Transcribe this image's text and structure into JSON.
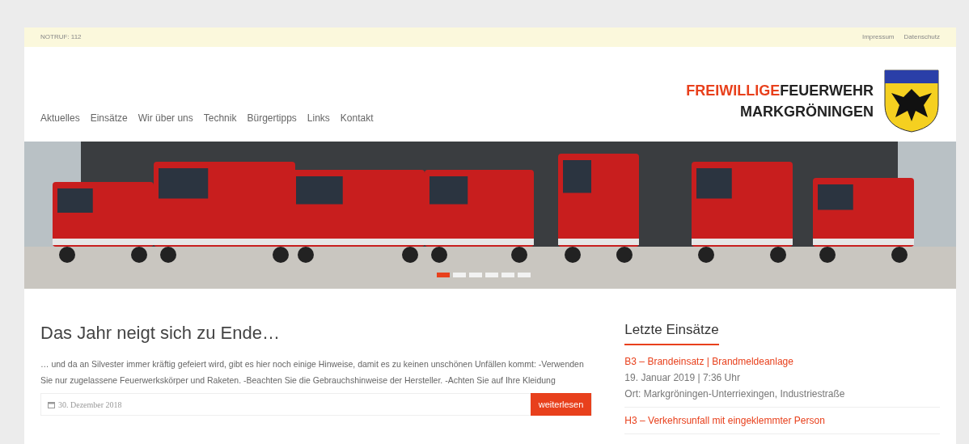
{
  "topbar": {
    "emergency": "NOTRUF: 112",
    "links": [
      "Impressum",
      "Datenschutz"
    ]
  },
  "nav": [
    "Aktuelles",
    "Einsätze",
    "Wir über uns",
    "Technik",
    "Bürgertipps",
    "Links",
    "Kontakt"
  ],
  "logo": {
    "line1_accent": "FREIWILLIGE",
    "line1_rest": "FEUERWEHR",
    "line2": "MARKGRÖNINGEN"
  },
  "slider": {
    "dots": [
      {
        "selected": true
      },
      {
        "selected": false
      },
      {
        "selected": false
      },
      {
        "selected": false
      },
      {
        "selected": false
      },
      {
        "selected": false
      }
    ]
  },
  "post": {
    "title": "Das Jahr neigt sich zu Ende…",
    "excerpt": "… und da an Silvester immer kräftig gefeiert wird, gibt es hier noch einige Hinweise, damit es zu keinen unschönen Unfällen kommt: -Verwenden Sie nur zugelassene Feuerwerkskörper und Raketen. -Beachten Sie die Gebrauchshinweise der Hersteller. -Achten Sie auf Ihre Kleidung",
    "date": "30. Dezember 2018",
    "button": "weiterlesen"
  },
  "sidebar": {
    "title": "Letzte Einsätze",
    "items": [
      {
        "title": "B3 – Brandeinsatz | Brandmeldeanlage",
        "date": "19. Januar 2019 | 7:36 Uhr",
        "place": "Ort: Markgröningen-Unterriexingen, Industriestraße"
      },
      {
        "title": "H3 – Verkehrsunfall mit eingeklemmter Person"
      }
    ]
  }
}
